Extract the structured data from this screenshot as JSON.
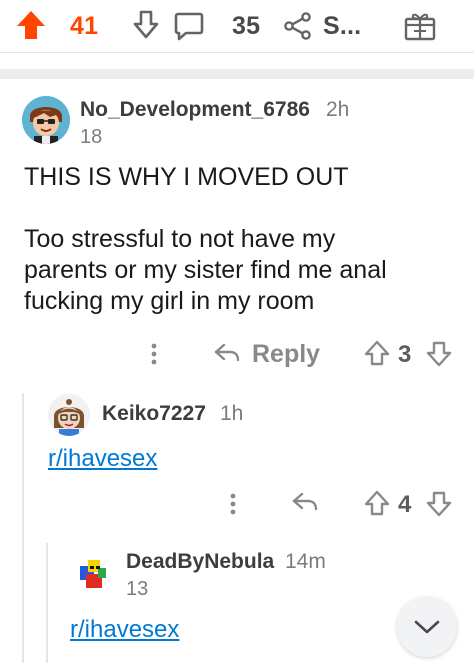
{
  "post_actions": {
    "upvote_count": "41",
    "comment_count": "35",
    "share_label": "S...",
    "upvote_icon": "upvote-arrow-filled-icon",
    "downvote_icon": "downvote-arrow-icon",
    "comment_icon": "comment-bubble-icon",
    "share_icon": "share-icon",
    "award_icon": "gift-award-icon",
    "accent_color": "#ff4500"
  },
  "comments": [
    {
      "username": "No_Development_6786",
      "time": "2h",
      "flair": "18",
      "body_lines": [
        "THIS IS WHY I MOVED OUT",
        "",
        "Too stressful to not have my",
        "parents or my sister find me anal",
        "fucking my girl in my room"
      ],
      "reply_label": "Reply",
      "vote_count": "3"
    },
    {
      "username": "Keiko7227",
      "time": "1h",
      "link": "r/ihavesex",
      "vote_count": "4"
    },
    {
      "username": "DeadByNebula",
      "time": "14m",
      "flair": "13",
      "link": "r/ihavesex"
    }
  ],
  "scroll_button_icon": "chevron-down-icon",
  "link_color": "#0079d3"
}
